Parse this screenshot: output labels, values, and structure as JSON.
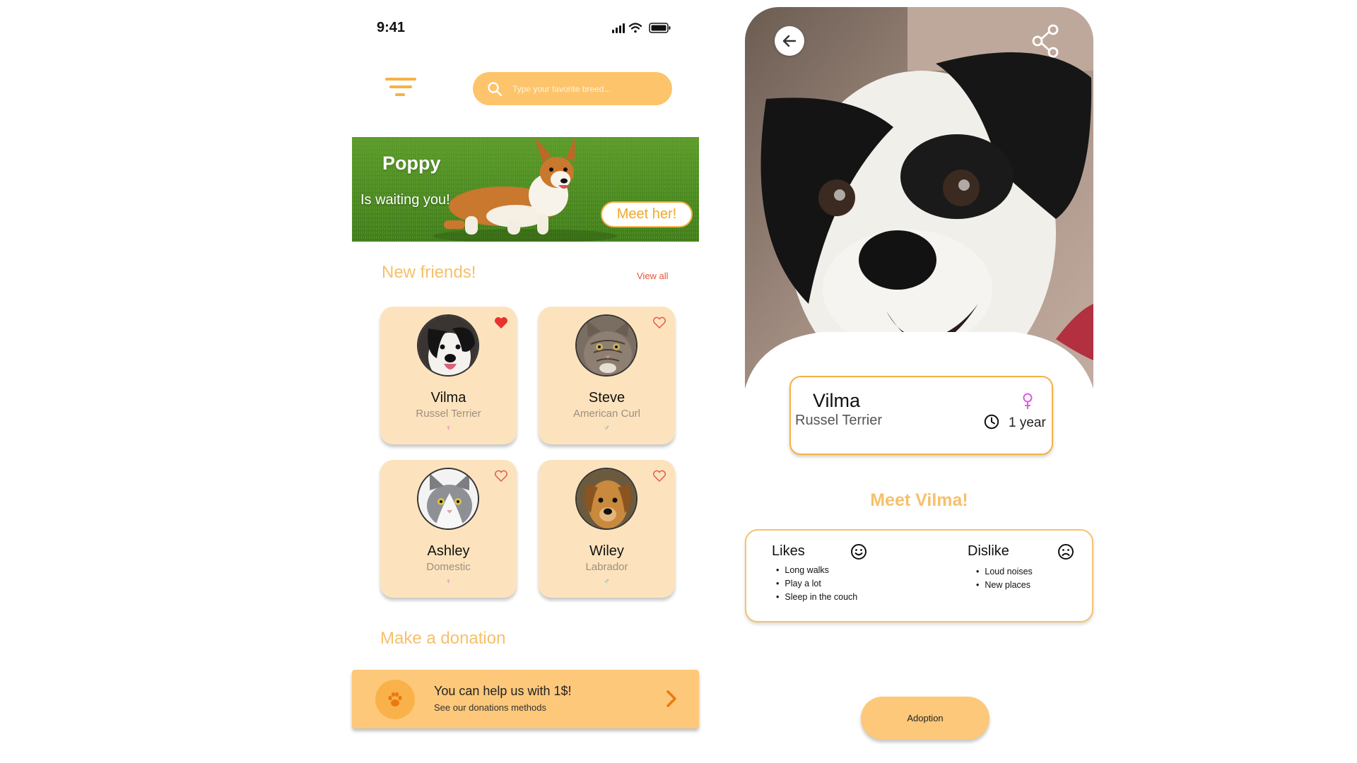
{
  "status_bar": {
    "time": "9:41"
  },
  "search": {
    "placeholder": "Type your favorite breed..."
  },
  "banner": {
    "title": "Poppy",
    "subtitle": "Is waiting you!",
    "button": "Meet her!"
  },
  "new_friends": {
    "title": "New friends!",
    "view_all": "View all",
    "pets": [
      {
        "name": "Vilma",
        "breed": "Russel Terrier",
        "gender": "♀",
        "gender_color": "#e05adf",
        "favorite": true,
        "image": "black-white-dog"
      },
      {
        "name": "Steve",
        "breed": "American Curl",
        "gender": "♂",
        "gender_color": "#2aa6c8",
        "favorite": false,
        "image": "tabby-cat"
      },
      {
        "name": "Ashley",
        "breed": "Domestic",
        "gender": "♀",
        "gender_color": "#e05adf",
        "favorite": false,
        "image": "grey-white-cat"
      },
      {
        "name": "Wiley",
        "breed": "Labrador",
        "gender": "♂",
        "gender_color": "#2aa6c8",
        "favorite": false,
        "image": "tan-dog"
      }
    ]
  },
  "donation": {
    "title": "Make a donation",
    "card_title": "You can help us with 1$!",
    "card_subtitle": "See our donations methods",
    "icon": "paw-icon"
  },
  "detail": {
    "name": "Vilma",
    "breed": "Russel Terrier",
    "age": "1 year",
    "gender": "♀",
    "meet_title": "Meet Vilma!",
    "likes_title": "Likes",
    "likes": [
      "Long walks",
      "Play a lot",
      "Sleep in the couch"
    ],
    "dislike_title": "Dislike",
    "dislikes": [
      "Loud noises",
      "New places"
    ],
    "adopt_button": "Adoption"
  },
  "colors": {
    "accent": "#f4b245",
    "card_bg": "#fde3bd",
    "button_bg": "#fdc87a",
    "heart_active": "#e8322e",
    "heart_outline": "#e05a4a",
    "view_all": "#e8533a"
  }
}
